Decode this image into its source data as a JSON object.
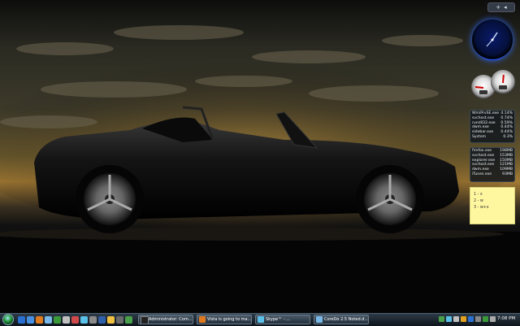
{
  "desktop": {
    "wallpaper": "black convertible sports car at dusk",
    "gadget_toolbar": {
      "add_label": "+",
      "nav_label": "◂"
    }
  },
  "gadgets": {
    "clock": {
      "icon": "analog-clock-icon"
    },
    "meters": {
      "cpu_percent": 15,
      "memory_percent": 52
    },
    "top_cpu": [
      {
        "name": "WmiPrvSE.exe",
        "value": "4.14%"
      },
      {
        "name": "svchost.exe",
        "value": "0.74%"
      },
      {
        "name": "rundll32.exe",
        "value": "0.59%"
      },
      {
        "name": "dwm.exe",
        "value": "0.44%"
      },
      {
        "name": "sidebar.exe",
        "value": "0.44%"
      },
      {
        "name": "System",
        "value": "0.3%"
      }
    ],
    "top_memory": [
      {
        "name": "firefox.exe",
        "value": "198MB"
      },
      {
        "name": "svchost.exe",
        "value": "153MB"
      },
      {
        "name": "explorer.exe",
        "value": "150MB"
      },
      {
        "name": "svchost.exe",
        "value": "121MB"
      },
      {
        "name": "dwm.exe",
        "value": "109MB"
      },
      {
        "name": "iTunes.exe",
        "value": "93MB"
      }
    ],
    "notes": [
      "1 - x",
      "2 - w",
      "3 - w+x"
    ]
  },
  "taskbar": {
    "tasks": [
      {
        "label": "Administrator: Com...",
        "icon": "terminal-icon"
      },
      {
        "label": "Vista is going to ma...",
        "icon": "firefox-icon"
      },
      {
        "label": "Skype™ - ...",
        "icon": "skype-icon"
      },
      {
        "label": "CoreDo 2.5 Noted.d...",
        "icon": "notepad-icon"
      }
    ],
    "clock": "7:08 PM",
    "colors": {
      "accent": "#2e6bff",
      "taskbar": "#1a242e"
    }
  }
}
